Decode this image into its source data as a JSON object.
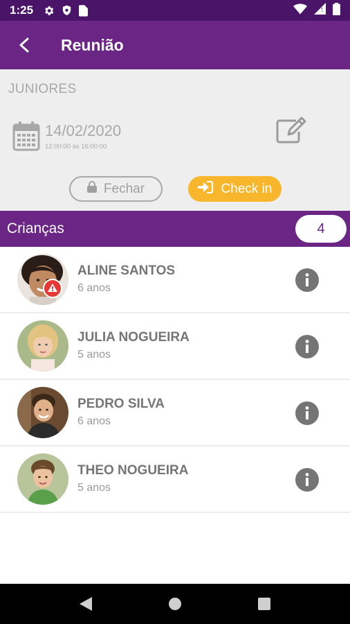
{
  "status_bar": {
    "time": "1:25",
    "icons": [
      "gear-icon",
      "shield-icon",
      "sim-card-icon"
    ],
    "right_icons": [
      "wifi-icon",
      "signal-icon",
      "battery-icon"
    ]
  },
  "app_bar": {
    "title": "Reunião",
    "back_icon": "back-arrow-icon"
  },
  "meeting": {
    "group": "JUNIORES",
    "date": "14/02/2020",
    "time_range": "12:00:00 às 16:00:00",
    "close_label": "Fechar",
    "checkin_label": "Check in"
  },
  "kids": {
    "title": "Crianças",
    "count": "4",
    "items": [
      {
        "name": "ALINE SANTOS",
        "age": "6 anos",
        "has_alert": true
      },
      {
        "name": "JULIA NOGUEIRA",
        "age": "5 anos",
        "has_alert": false
      },
      {
        "name": "PEDRO SILVA",
        "age": "6 anos",
        "has_alert": false
      },
      {
        "name": "THEO NOGUEIRA",
        "age": "5 anos",
        "has_alert": false
      }
    ]
  },
  "colors": {
    "primary": "#6a2585",
    "status_bar": "#4a1468",
    "accent": "#f7b62b",
    "alert": "#e53935"
  },
  "nav_bar": [
    "back-triangle-icon",
    "home-circle-icon",
    "recents-square-icon"
  ]
}
